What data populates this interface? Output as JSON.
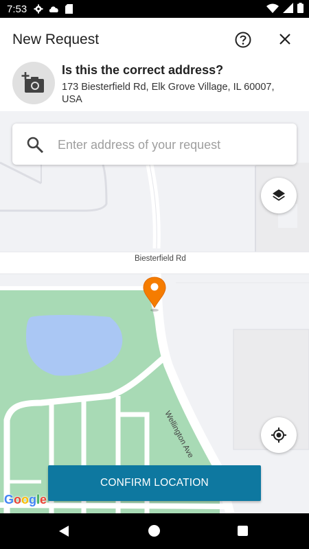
{
  "status_bar": {
    "time": "7:53"
  },
  "header": {
    "title": "New Request",
    "help_icon": "help-circle-icon",
    "close_icon": "close-icon"
  },
  "address_panel": {
    "photo_icon": "add-photo-icon",
    "question": "Is this the correct address?",
    "address": "173 Biesterfield Rd, Elk Grove Village, IL 60007, USA"
  },
  "map": {
    "search": {
      "placeholder": "Enter address of your request",
      "value": ""
    },
    "road_labels": [
      "Biesterfield Rd",
      "Wellington Ave"
    ],
    "pin_color": "#f57c00",
    "confirm_label": "CONFIRM LOCATION",
    "confirm_color": "#0e78a0",
    "attribution": "Google"
  },
  "nav_bar": {
    "back_icon": "nav-back-icon",
    "home_icon": "nav-home-icon",
    "recents_icon": "nav-recents-icon"
  }
}
